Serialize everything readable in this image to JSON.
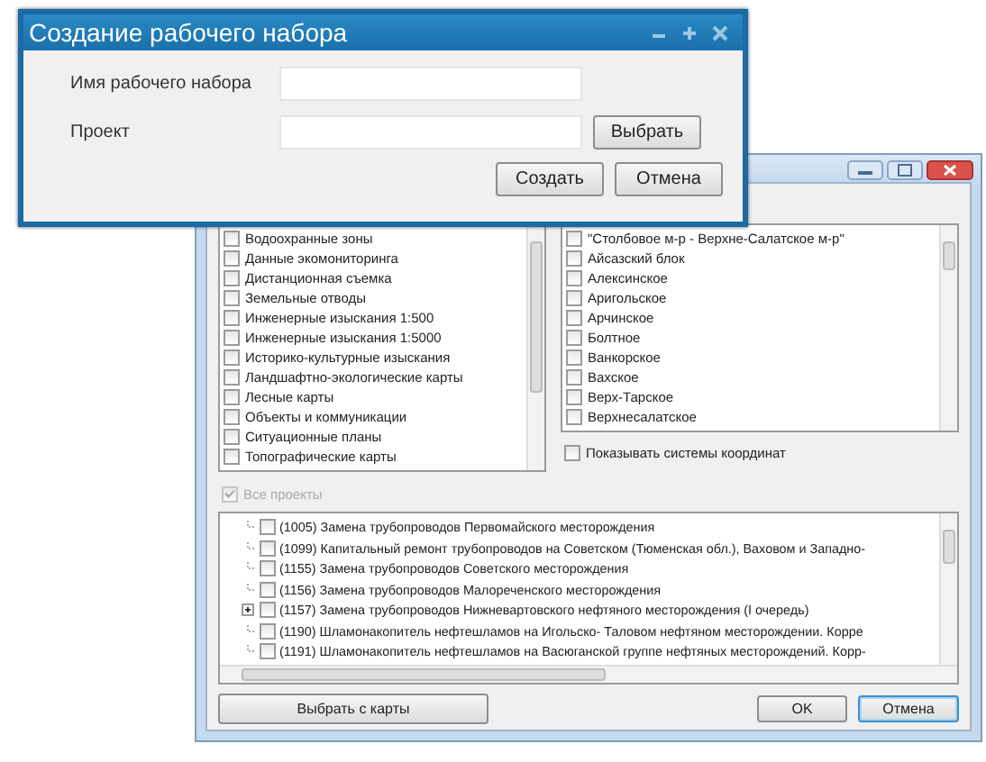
{
  "back_window": {
    "layers": [
      {
        "label": "Водоохранные зоны",
        "checked": false
      },
      {
        "label": "Данные экомониторинга",
        "checked": false
      },
      {
        "label": "Дистанционная съемка",
        "checked": false
      },
      {
        "label": "Земельные отводы",
        "checked": false
      },
      {
        "label": "Инженерные изыскания 1:500",
        "checked": false
      },
      {
        "label": "Инженерные изыскания 1:5000",
        "checked": false
      },
      {
        "label": "Историко-культурные изыскания",
        "checked": false
      },
      {
        "label": "Ландшафтно-экологические карты",
        "checked": false
      },
      {
        "label": "Лесные карты",
        "checked": false
      },
      {
        "label": "Объекты и коммуникации",
        "checked": false
      },
      {
        "label": "Ситуационные планы",
        "checked": false
      },
      {
        "label": "Топографические карты",
        "checked": false
      }
    ],
    "fields": [
      {
        "label": "\"Столбовое м-р - Верхне-Салатское м-р\"",
        "checked": false
      },
      {
        "label": "Айсазский блок",
        "checked": false
      },
      {
        "label": "Алексинское",
        "checked": false
      },
      {
        "label": "Аригольское",
        "checked": false
      },
      {
        "label": "Арчинское",
        "checked": false
      },
      {
        "label": "Болтное",
        "checked": false
      },
      {
        "label": "Ванкорское",
        "checked": false
      },
      {
        "label": "Вахское",
        "checked": false
      },
      {
        "label": "Верх-Тарское",
        "checked": false
      },
      {
        "label": "Верхнесалатское",
        "checked": false
      }
    ],
    "show_coordinate_systems": {
      "label": "Показывать системы координат",
      "checked": false
    },
    "all_projects": {
      "label": "Все проекты",
      "checked": true,
      "disabled": true
    },
    "projects": [
      {
        "kind": "leaf",
        "label": "(1005) Замена трубопроводов Первомайского месторождения",
        "checked": false
      },
      {
        "kind": "leaf",
        "label": "(1099) Капитальный ремонт трубопроводов на Советском (Тюменская обл.), Ваховом и Западно-",
        "checked": false
      },
      {
        "kind": "leaf",
        "label": "(1155) Замена трубопроводов Советского месторождения",
        "checked": false
      },
      {
        "kind": "leaf",
        "label": "(1156) Замена трубопроводов Малореченского месторождения",
        "checked": false
      },
      {
        "kind": "group",
        "expanded": false,
        "label": "(1157) Замена трубопроводов Нижневартовского нефтяного месторождения (I очередь)",
        "checked": false
      },
      {
        "kind": "leaf",
        "label": "(1190) Шламонакопитель нефтешламов на Игольско- Таловом нефтяном месторождении. Корре",
        "checked": false
      },
      {
        "kind": "leaf",
        "label": "(1191) Шламонакопитель нефтешламов на Васюганской группе нефтяных месторождений. Корр-",
        "checked": false
      }
    ],
    "buttons": {
      "pick_on_map": "Выбрать с карты",
      "ok": "OK",
      "cancel": "Отмена"
    }
  },
  "dialog": {
    "title": "Создание рабочего набора",
    "fields": [
      {
        "label": "Имя рабочего набора"
      },
      {
        "label": "Проект",
        "button": "Выбрать"
      }
    ],
    "buttons": [
      "Создать",
      "Отмена"
    ]
  }
}
